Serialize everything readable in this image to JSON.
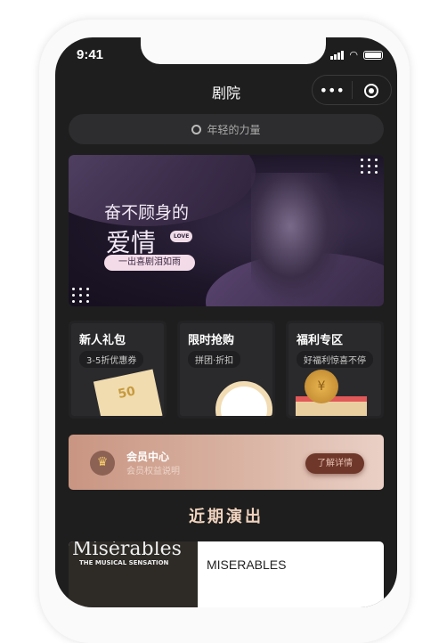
{
  "status": {
    "time": "9:41"
  },
  "nav": {
    "title": "剧院",
    "more_icon": "•••"
  },
  "search": {
    "placeholder": "年轻的力量"
  },
  "banner": {
    "line1": "奋不顾身的",
    "line2": "爱情",
    "badge": "LOVE",
    "tagline": "一出喜剧泪如雨"
  },
  "cards": [
    {
      "title": "新人礼包",
      "subtitle": "3-5折优惠券",
      "art_text": "50"
    },
    {
      "title": "限时抢购",
      "subtitle": "拼团·折扣"
    },
    {
      "title": "福利专区",
      "subtitle": "好福利惊喜不停",
      "art_text": "¥"
    }
  ],
  "member": {
    "title": "会员中心",
    "subtitle": "会员权益说明",
    "button": "了解详情"
  },
  "section": {
    "title": "近期演出"
  },
  "show": {
    "poster_title": "Misérables",
    "poster_sub": "THE MUSICAL SENSATION",
    "name": "MISERABLES"
  }
}
